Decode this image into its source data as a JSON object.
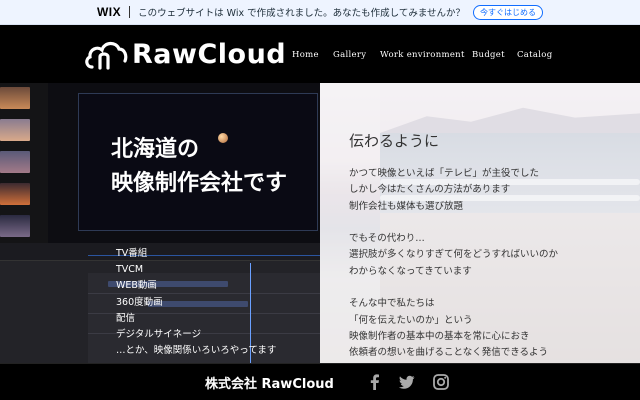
{
  "wix_banner": {
    "logo": "WIX",
    "message": "このウェブサイトは Wix で作成されました。あなたも作成してみませんか？",
    "cta": "今すぐはじめる"
  },
  "header": {
    "brand": "RawCloud",
    "nav": [
      "Home",
      "Gallery",
      "Work environment",
      "Budget",
      "Catalog"
    ]
  },
  "hero": {
    "title_lines": [
      "北海道の",
      "映像制作会社です"
    ],
    "services": [
      "TV番組",
      "TVCM",
      "WEB動画",
      "360度動画",
      "配信",
      "デジタルサイネージ",
      "…とか、映像関係いろいろやってます"
    ],
    "right_heading": "伝わるように",
    "right_paragraph": [
      "かつて映像といえば「テレビ」が主役でした",
      "しかし今はたくさんの方法があります",
      "制作会社も媒体も選び放題",
      "",
      "でもその代わり…",
      "選択肢が多くなりすぎて何をどうすればいいのか",
      "わからなくなってきています",
      "",
      "そんな中で私たちは",
      "「何を伝えたいのか」という",
      "映像制作者の基本中の基本を常に心におき",
      "依頼者の想いを曲げることなく発信できるよう"
    ]
  },
  "footer": {
    "company": "株式会社 RawCloud",
    "social": [
      "facebook-icon",
      "twitter-icon",
      "instagram-icon"
    ]
  }
}
